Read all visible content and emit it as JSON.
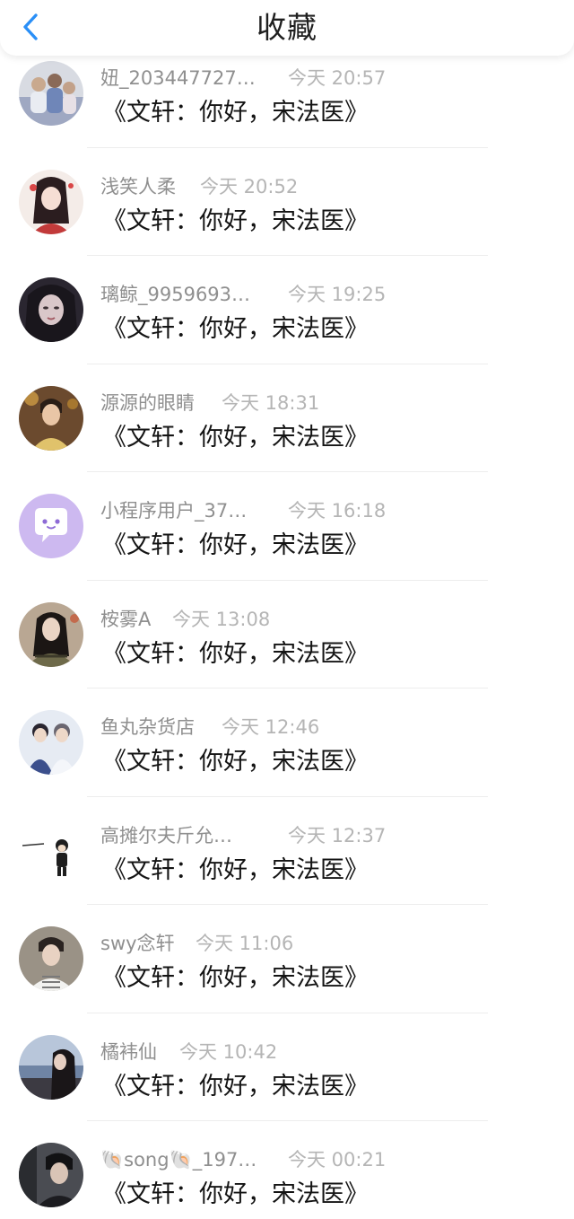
{
  "header": {
    "title": "收藏",
    "back_icon": "chevron-left-icon",
    "accent_color": "#2a8ff7"
  },
  "items": [
    {
      "user": "妞_203447727…",
      "time": "今天 20:57",
      "content": "《文轩：你好，宋法医》",
      "avatar_icon": "family-photo-avatar"
    },
    {
      "user": "浅笑人柔",
      "time": "今天 20:52",
      "content": "《文轩：你好，宋法医》",
      "avatar_icon": "illustrated-girl-avatar"
    },
    {
      "user": "璃鲸_9959693…",
      "time": "今天 19:25",
      "content": "《文轩：你好，宋法医》",
      "avatar_icon": "dark-portrait-avatar"
    },
    {
      "user": "源源的眼睛",
      "time": "今天 18:31",
      "content": "《文轩：你好，宋法医》",
      "avatar_icon": "boy-photo-avatar"
    },
    {
      "user": "小程序用户_37…",
      "time": "今天 16:18",
      "content": "《文轩：你好，宋法医》",
      "avatar_icon": "mini-program-chat-avatar"
    },
    {
      "user": "桉雾A",
      "time": "今天 13:08",
      "content": "《文轩：你好，宋法医》",
      "avatar_icon": "girl-photo-avatar"
    },
    {
      "user": "鱼丸杂货店",
      "time": "今天 12:46",
      "content": "《文轩：你好，宋法医》",
      "avatar_icon": "two-boys-avatar"
    },
    {
      "user": "高摊尔夫斤允…",
      "time": "今天 12:37",
      "content": "《文轩：你好，宋法医》",
      "avatar_icon": "cartoon-figure-avatar"
    },
    {
      "user": "swy念轩",
      "time": "今天 11:06",
      "content": "《文轩：你好，宋法医》",
      "avatar_icon": "boy-portrait-avatar"
    },
    {
      "user": "橘袆仙",
      "time": "今天 10:42",
      "content": "《文轩：你好，宋法医》",
      "avatar_icon": "seaside-avatar"
    },
    {
      "user": "🐚song🐚_197…",
      "time": "今天 00:21",
      "content": "《文轩：你好，宋法医》",
      "avatar_icon": "dark-boy-avatar"
    }
  ]
}
